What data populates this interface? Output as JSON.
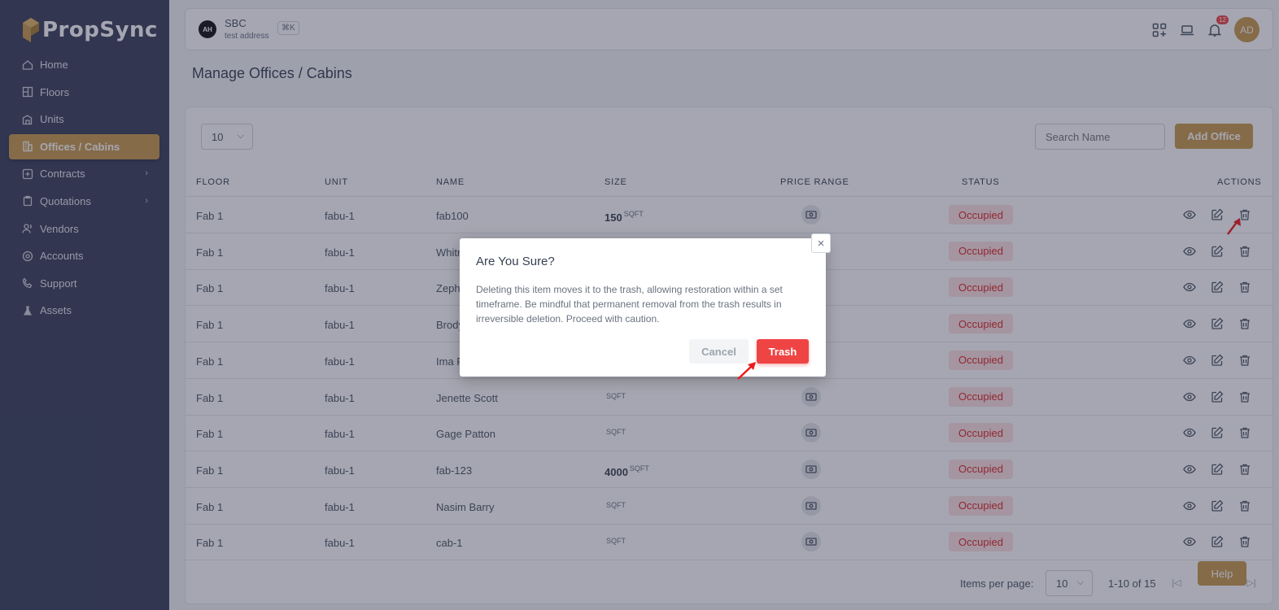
{
  "brand": {
    "name": "PropSync"
  },
  "sidebar": {
    "items": [
      {
        "label": "Home",
        "icon": "home-icon"
      },
      {
        "label": "Floors",
        "icon": "floors-icon"
      },
      {
        "label": "Units",
        "icon": "units-icon"
      },
      {
        "label": "Offices / Cabins",
        "icon": "offices-icon",
        "active": true
      },
      {
        "label": "Contracts",
        "icon": "contracts-icon",
        "submenu": true
      },
      {
        "label": "Quotations",
        "icon": "quotations-icon",
        "submenu": true
      },
      {
        "label": "Vendors",
        "icon": "vendors-icon"
      },
      {
        "label": "Accounts",
        "icon": "accounts-icon"
      },
      {
        "label": "Support",
        "icon": "support-icon"
      },
      {
        "label": "Assets",
        "icon": "assets-icon"
      }
    ]
  },
  "topbar": {
    "org_logo_text": "AH",
    "org_name": "SBC",
    "org_address": "test address",
    "shortcut": "⌘K",
    "notifications_count": "12",
    "avatar_initials": "AD"
  },
  "page": {
    "title": "Manage Offices / Cabins"
  },
  "toolbar": {
    "per_page": "10",
    "search_placeholder": "Search Name",
    "add_label": "Add Office"
  },
  "table": {
    "columns": [
      "FLOOR",
      "UNIT",
      "NAME",
      "SIZE",
      "PRICE RANGE",
      "STATUS",
      "ACTIONS"
    ],
    "rows": [
      {
        "floor": "Fab 1",
        "unit": "fabu-1",
        "name": "fab100",
        "size": "150",
        "unit_label": "SQFT",
        "status": "Occupied"
      },
      {
        "floor": "Fab 1",
        "unit": "fabu-1",
        "name": "Whitn",
        "size": "",
        "unit_label": "",
        "status": "Occupied"
      },
      {
        "floor": "Fab 1",
        "unit": "fabu-1",
        "name": "Zeph",
        "size": "",
        "unit_label": "",
        "status": "Occupied"
      },
      {
        "floor": "Fab 1",
        "unit": "fabu-1",
        "name": "Brody",
        "size": "",
        "unit_label": "",
        "status": "Occupied"
      },
      {
        "floor": "Fab 1",
        "unit": "fabu-1",
        "name": "Ima P",
        "size": "",
        "unit_label": "",
        "status": "Occupied"
      },
      {
        "floor": "Fab 1",
        "unit": "fabu-1",
        "name": "Jenette Scott",
        "size": "",
        "unit_label": "SQFT",
        "status": "Occupied"
      },
      {
        "floor": "Fab 1",
        "unit": "fabu-1",
        "name": "Gage Patton",
        "size": "",
        "unit_label": "SQFT",
        "status": "Occupied"
      },
      {
        "floor": "Fab 1",
        "unit": "fabu-1",
        "name": "fab-123",
        "size": "4000",
        "unit_label": "SQFT",
        "status": "Occupied"
      },
      {
        "floor": "Fab 1",
        "unit": "fabu-1",
        "name": "Nasim Barry",
        "size": "",
        "unit_label": "SQFT",
        "status": "Occupied"
      },
      {
        "floor": "Fab 1",
        "unit": "fabu-1",
        "name": "cab-1",
        "size": "",
        "unit_label": "SQFT",
        "status": "Occupied"
      }
    ]
  },
  "pagination": {
    "label": "Items per page:",
    "per_page": "10",
    "range": "1-10 of 15"
  },
  "help": {
    "label": "Help"
  },
  "modal": {
    "title": "Are You Sure?",
    "body": "Deleting this item moves it to the trash, allowing restoration within a set timeframe. Be mindful that permanent removal from the trash results in irreversible deletion. Proceed with caution.",
    "cancel_label": "Cancel",
    "confirm_label": "Trash",
    "close_symbol": "×"
  },
  "colors": {
    "sidebar_bg": "#3a3f59",
    "accent": "#c89a4a",
    "danger": "#ef4444",
    "status_bg": "#fde2e2"
  }
}
